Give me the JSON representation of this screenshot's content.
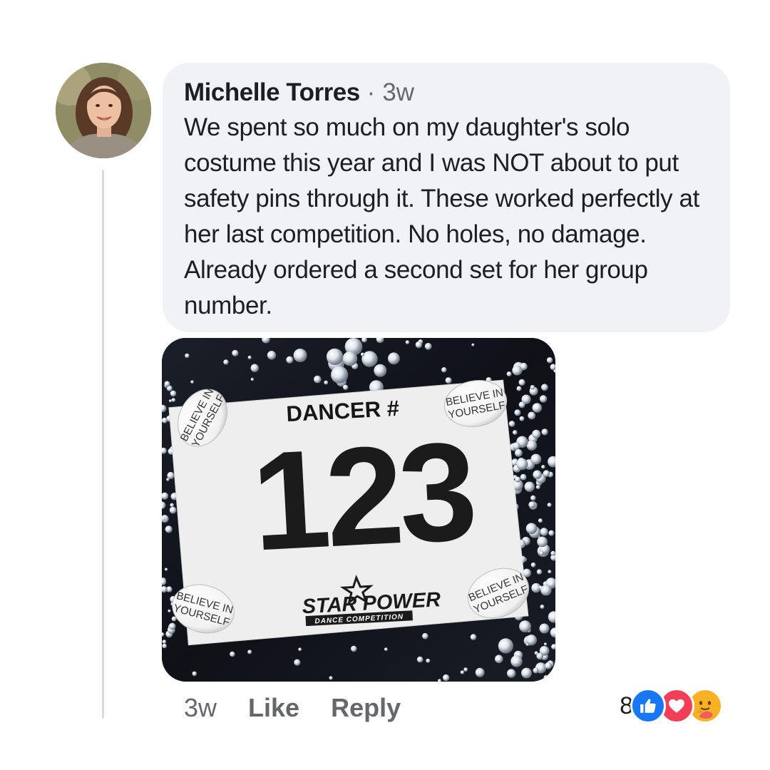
{
  "comment": {
    "author": "Michelle Torres",
    "separator": "·",
    "time": "3w",
    "text": "We spent so much on my daughter's solo costume this year and I was NOT about to put safety pins through it. These worked perfectly at her last competition. No holes, no damage. Already ordered a second set for her group number."
  },
  "photo": {
    "bib_heading": "DANCER #",
    "bib_number": "123",
    "brand_name": "STAR POWER",
    "brand_tagline": "DANCE COMPETITION",
    "magnet_text_line1": "BELIEVE IN",
    "magnet_text_line2": "YOURSELF"
  },
  "actions": {
    "time": "3w",
    "like_label": "Like",
    "reply_label": "Reply"
  },
  "reactions": {
    "count": "8",
    "icons": [
      "like-icon",
      "love-icon",
      "care-icon"
    ]
  },
  "colors": {
    "bubble": "#f0f2f5",
    "like": "#1877f2",
    "love": "#f33e58",
    "care": "#f7b125",
    "secondary_text": "#65676b"
  }
}
